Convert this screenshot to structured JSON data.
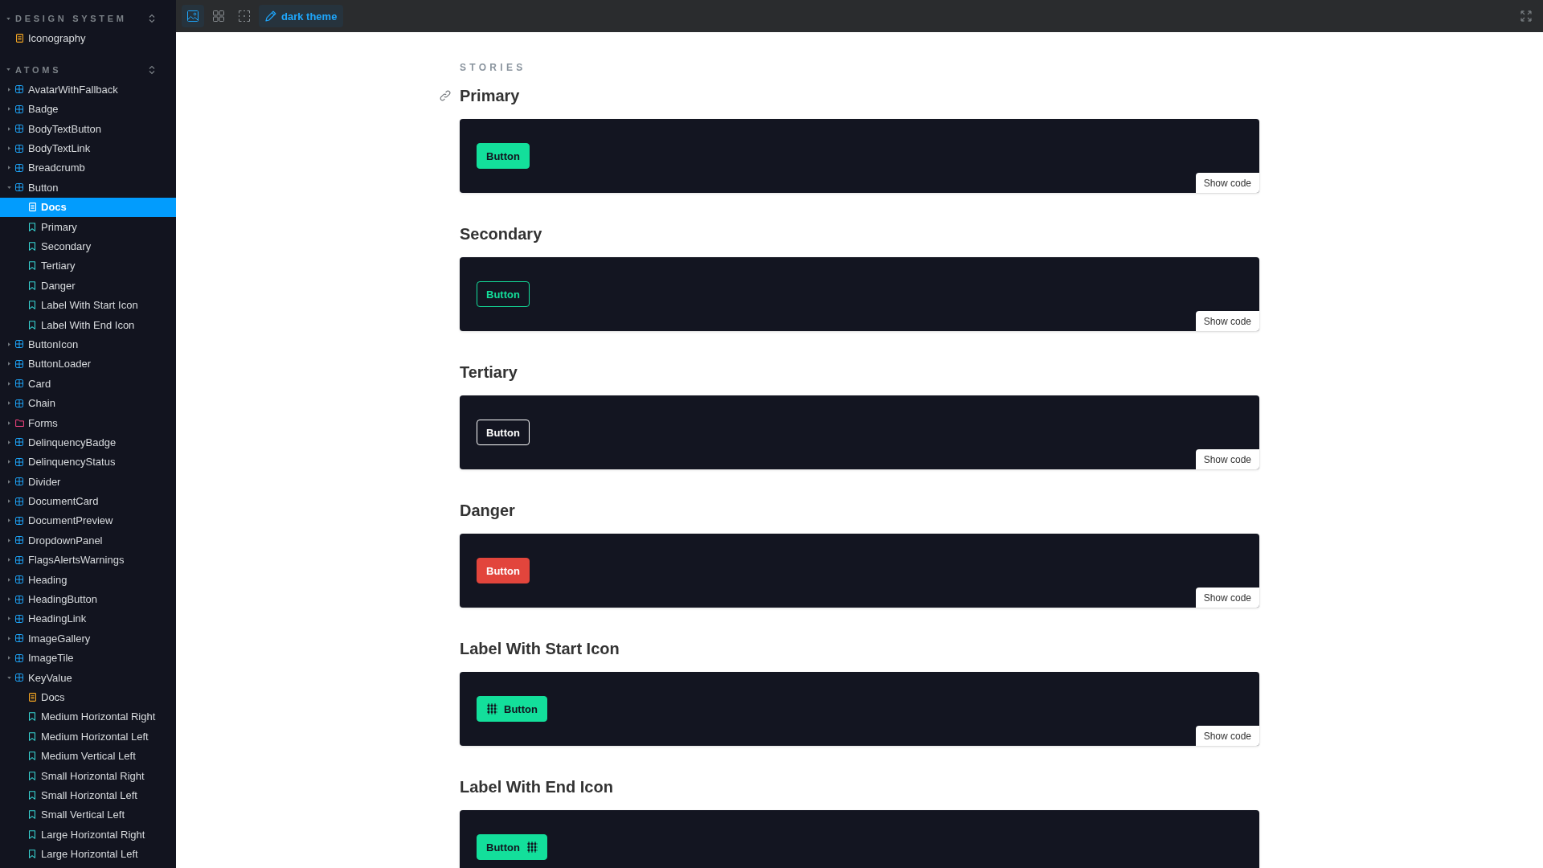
{
  "toolbar": {
    "tools": [
      {
        "selected": true
      },
      {
        "selected": false
      },
      {
        "selected": false
      }
    ],
    "theme_toggle": {
      "label": "dark theme",
      "selected": true
    }
  },
  "sidebar": {
    "sections": [
      {
        "title": "DESIGN SYSTEM",
        "expanded": true,
        "items": [
          {
            "label": "Iconography",
            "kind": "docs",
            "selected": false
          }
        ]
      },
      {
        "title": "ATOMS",
        "expanded": true,
        "items": [
          {
            "label": "AvatarWithFallback",
            "kind": "component",
            "expanded": false,
            "selected": false
          },
          {
            "label": "Badge",
            "kind": "component",
            "expanded": false,
            "selected": false
          },
          {
            "label": "BodyTextButton",
            "kind": "component",
            "expanded": false,
            "selected": false
          },
          {
            "label": "BodyTextLink",
            "kind": "component",
            "expanded": false,
            "selected": false
          },
          {
            "label": "Breadcrumb",
            "kind": "component",
            "expanded": false,
            "selected": false
          },
          {
            "label": "Button",
            "kind": "component",
            "expanded": true,
            "selected": false,
            "children": [
              {
                "label": "Docs",
                "kind": "docs",
                "selected": true
              },
              {
                "label": "Primary",
                "kind": "story",
                "selected": false
              },
              {
                "label": "Secondary",
                "kind": "story",
                "selected": false
              },
              {
                "label": "Tertiary",
                "kind": "story",
                "selected": false
              },
              {
                "label": "Danger",
                "kind": "story",
                "selected": false
              },
              {
                "label": "Label With Start Icon",
                "kind": "story",
                "selected": false
              },
              {
                "label": "Label With End Icon",
                "kind": "story",
                "selected": false
              }
            ]
          },
          {
            "label": "ButtonIcon",
            "kind": "component",
            "expanded": false,
            "selected": false
          },
          {
            "label": "ButtonLoader",
            "kind": "component",
            "expanded": false,
            "selected": false
          },
          {
            "label": "Card",
            "kind": "component",
            "expanded": false,
            "selected": false
          },
          {
            "label": "Chain",
            "kind": "component",
            "expanded": false,
            "selected": false
          },
          {
            "label": "Forms",
            "kind": "folder",
            "expanded": false,
            "selected": false
          },
          {
            "label": "DelinquencyBadge",
            "kind": "component",
            "expanded": false,
            "selected": false
          },
          {
            "label": "DelinquencyStatus",
            "kind": "component",
            "expanded": false,
            "selected": false
          },
          {
            "label": "Divider",
            "kind": "component",
            "expanded": false,
            "selected": false
          },
          {
            "label": "DocumentCard",
            "kind": "component",
            "expanded": false,
            "selected": false
          },
          {
            "label": "DocumentPreview",
            "kind": "component",
            "expanded": false,
            "selected": false
          },
          {
            "label": "DropdownPanel",
            "kind": "component",
            "expanded": false,
            "selected": false
          },
          {
            "label": "FlagsAlertsWarnings",
            "kind": "component",
            "expanded": false,
            "selected": false
          },
          {
            "label": "Heading",
            "kind": "component",
            "expanded": false,
            "selected": false
          },
          {
            "label": "HeadingButton",
            "kind": "component",
            "expanded": false,
            "selected": false
          },
          {
            "label": "HeadingLink",
            "kind": "component",
            "expanded": false,
            "selected": false
          },
          {
            "label": "ImageGallery",
            "kind": "component",
            "expanded": false,
            "selected": false
          },
          {
            "label": "ImageTile",
            "kind": "component",
            "expanded": false,
            "selected": false
          },
          {
            "label": "KeyValue",
            "kind": "component",
            "expanded": true,
            "selected": false,
            "children": [
              {
                "label": "Docs",
                "kind": "docs",
                "selected": false
              },
              {
                "label": "Medium Horizontal Right",
                "kind": "story",
                "selected": false
              },
              {
                "label": "Medium Horizontal Left",
                "kind": "story",
                "selected": false
              },
              {
                "label": "Medium Vertical Left",
                "kind": "story",
                "selected": false
              },
              {
                "label": "Small Horizontal Right",
                "kind": "story",
                "selected": false
              },
              {
                "label": "Small Horizontal Left",
                "kind": "story",
                "selected": false
              },
              {
                "label": "Small Vertical Left",
                "kind": "story",
                "selected": false
              },
              {
                "label": "Large Horizontal Right",
                "kind": "story",
                "selected": false
              },
              {
                "label": "Large Horizontal Left",
                "kind": "story",
                "selected": false
              }
            ]
          }
        ]
      }
    ]
  },
  "docs": {
    "section_label": "STORIES",
    "stories": [
      {
        "title": "Primary",
        "show_anchor": true,
        "kind": "primary",
        "label": "Button",
        "show_code": "Show code"
      },
      {
        "title": "Secondary",
        "show_anchor": false,
        "kind": "secondary",
        "label": "Button",
        "show_code": "Show code"
      },
      {
        "title": "Tertiary",
        "show_anchor": false,
        "kind": "tertiary",
        "label": "Button",
        "show_code": "Show code"
      },
      {
        "title": "Danger",
        "show_anchor": false,
        "kind": "danger",
        "label": "Button",
        "show_code": "Show code"
      },
      {
        "title": "Label With Start Icon",
        "show_anchor": false,
        "kind": "start-icon",
        "label": "Button",
        "show_code": "Show code"
      },
      {
        "title": "Label With End Icon",
        "show_anchor": false,
        "kind": "end-icon",
        "label": "Button"
      }
    ]
  }
}
